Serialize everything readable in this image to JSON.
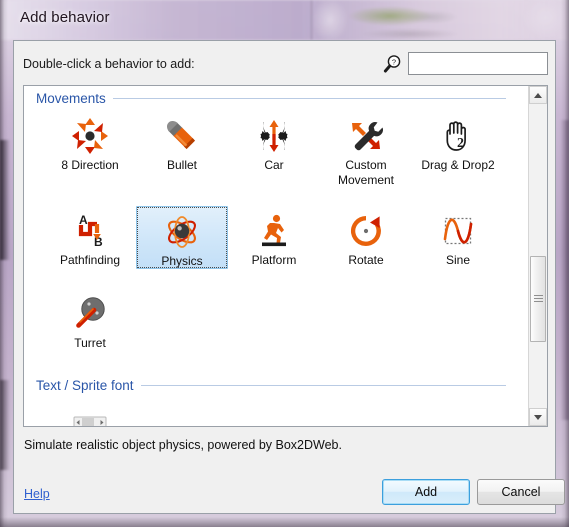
{
  "window": {
    "title": "Add behavior"
  },
  "dialog": {
    "prompt": "Double-click a behavior to add:",
    "search": {
      "value": "",
      "placeholder": "",
      "icon": "search-icon"
    },
    "description": "Simulate realistic object physics, powered by Box2DWeb.",
    "help_label": "Help",
    "add_label": "Add",
    "cancel_label": "Cancel"
  },
  "groups": [
    {
      "title": "Movements",
      "items": [
        {
          "label": "8 Direction",
          "icon": "eight-direction-icon",
          "selected": false
        },
        {
          "label": "Bullet",
          "icon": "bullet-icon",
          "selected": false
        },
        {
          "label": "Car",
          "icon": "car-icon",
          "selected": false
        },
        {
          "label": "Custom Movement",
          "icon": "custom-movement-icon",
          "selected": false
        },
        {
          "label": "Drag & Drop2",
          "icon": "drag-and-drop-icon",
          "selected": false
        },
        {
          "label": "Pathfinding",
          "icon": "pathfinding-icon",
          "selected": false
        },
        {
          "label": "Physics",
          "icon": "physics-icon",
          "selected": true
        },
        {
          "label": "Platform",
          "icon": "platform-icon",
          "selected": false
        },
        {
          "label": "Rotate",
          "icon": "rotate-icon",
          "selected": false
        },
        {
          "label": "Sine",
          "icon": "sine-icon",
          "selected": false
        },
        {
          "label": "Turret",
          "icon": "turret-icon",
          "selected": false
        }
      ]
    },
    {
      "title": "Text / Sprite font",
      "items": []
    }
  ],
  "colors": {
    "group_header": "#2a56a8",
    "selection_fill": "#cfe6f9",
    "selection_border": "#8fc5ea",
    "accent_orange": "#e8620c",
    "accent_red": "#cf2000",
    "link": "#2f5fcf",
    "default_button_border": "#3c9fdd"
  }
}
